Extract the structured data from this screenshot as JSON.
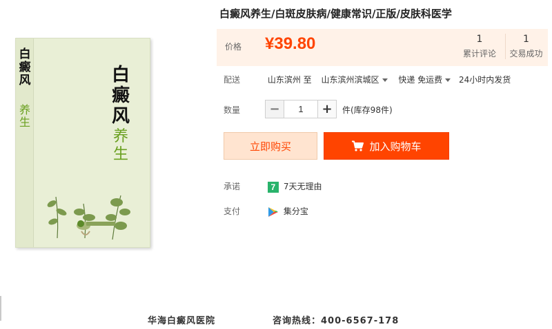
{
  "product": {
    "title": "白癜风养生/白斑皮肤病/健康常识/正版/皮肤科医学",
    "cover": {
      "title": "白癜风",
      "subtitle": "养生"
    }
  },
  "price": {
    "label": "价格",
    "value": "¥39.80"
  },
  "stats": {
    "reviews": {
      "count": "1",
      "label": "累计评论"
    },
    "sales": {
      "count": "1",
      "label": "交易成功"
    }
  },
  "delivery": {
    "label": "配送",
    "from": "山东滨州 至",
    "to": "山东滨州滨城区",
    "shipping": "快递 免运费",
    "ship_time": "24小时内发货"
  },
  "quantity": {
    "label": "数量",
    "value": "1",
    "minus": "−",
    "plus": "+",
    "stock": "件(库存98件)"
  },
  "buttons": {
    "buy_now": "立即购买",
    "add_to_cart": "加入购物车"
  },
  "promise": {
    "label": "承诺",
    "badge": "7",
    "text": "7天无理由"
  },
  "payment": {
    "label": "支付",
    "text": "集分宝"
  },
  "footer": {
    "hospital": "华海白癜风医院",
    "hotline": "咨询热线：400-6567-178"
  },
  "colors": {
    "accent": "#ff4400",
    "price_bg": "#fff2e8",
    "buy_bg": "#ffe4d0",
    "promise_green": "#29b36b",
    "cover_green": "#6aa020"
  },
  "icons": {
    "cart": "shopping-cart-icon",
    "promise": "seven-day-badge-icon",
    "payment": "jifenbao-icon",
    "caret": "chevron-down-icon"
  }
}
